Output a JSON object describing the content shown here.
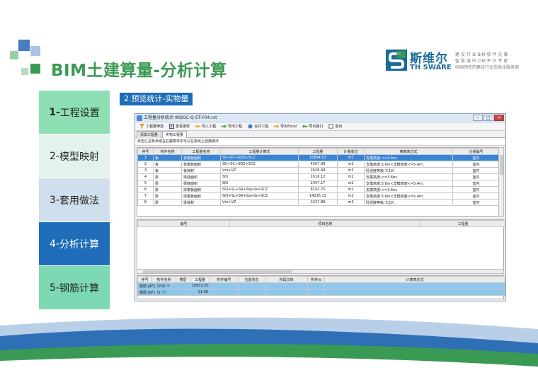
{
  "slide": {
    "title": "BIM土建算量-分析计算",
    "section_label": "2.预览统计-实物量",
    "colors": {
      "green": "#3a9a54",
      "blue": "#1f6db8"
    }
  },
  "logo": {
    "name_cn": "斯维尔",
    "name_en": "TH SWARE",
    "tagline_1": "建 设 行 业 BIM 软 件 先 锋",
    "tagline_2": "智 慧 城 市 CIM 平 台 专 家",
    "tagline_3": "中国领先的建设行业信息化服务商"
  },
  "nav": {
    "items": [
      {
        "num": "1-",
        "label": "工程设置"
      },
      {
        "num": "2-",
        "label": "模型映射"
      },
      {
        "num": "3-",
        "label": "套用做法"
      },
      {
        "num": "4-",
        "label": "分析计算"
      },
      {
        "num": "5-",
        "label": "钢筋计算"
      }
    ]
  },
  "window": {
    "title": "工程量分析统计-WDGC-Q-ST-F04.rvt",
    "controls": {
      "min": "–",
      "max": "□",
      "close": "×"
    },
    "toolbar": [
      "工程量筛选",
      "查看报表",
      "导入工程",
      "导出工程",
      "合并工程",
      "导出Excel",
      "导出接口",
      "退出"
    ],
    "tabs": [
      "清单工程量",
      "实物工程量"
    ],
    "hint": "双击汇总条目或在右键菜单中可以在条目上挂接做法",
    "top_table": {
      "headers": [
        "序号",
        "构件名称",
        "工程量名称",
        "工程量计算式",
        "工程量",
        "计量单位",
        "换算表达式",
        "分组编号"
      ],
      "rows": [
        [
          "1",
          "板",
          "板模板面积",
          "SD+SC+SDZ+SCZ",
          "10894.53",
          "m2",
          "支模高度:<=3.6m;",
          "室内"
        ],
        [
          "2",
          "板",
          "板模板面积",
          "SD+SC+SDZ+SCZ",
          "4507.08",
          "m2",
          "支模高度:3.6m<支模高度<=5.4m;",
          "室内"
        ],
        [
          "3",
          "板",
          "板体积",
          "Vm+VZ",
          "2628.49",
          "m3",
          "砼强度等级:'C30';",
          "室内"
        ],
        [
          "4",
          "梁",
          "梁底面积",
          "SDi",
          "1616.12",
          "m2",
          "支模高度:<=3.6m;",
          "室内"
        ],
        [
          "5",
          "梁",
          "梁底面积",
          "SDi",
          "2457.17",
          "m2",
          "支模高度:3.6m<支模高度<=5.4m;",
          "室内"
        ],
        [
          "6",
          "梁",
          "梁模板面积",
          "SDi+SL+SR+Sq+Sz+SCZ",
          "8192.75",
          "m2",
          "支模高度:<=3.6m;",
          "室内"
        ],
        [
          "7",
          "梁",
          "梁模板面积",
          "SDi+SL+SR+Sq+Sz+SCZ",
          "14236.13",
          "m2",
          "支模高度:3.6m<支模高度<=5.4m;",
          "室内"
        ],
        [
          "8",
          "梁",
          "梁体积",
          "Vm+VZ",
          "3237.88",
          "m3",
          "砼强度等级:'C30';",
          "室内"
        ]
      ]
    },
    "mid_table": {
      "headers": [
        "编号",
        "项目名称",
        "工程量"
      ]
    },
    "bottom_table": {
      "headers": [
        "序号",
        "构件名称",
        "楼层",
        "工程量",
        "构件编号",
        "位置信息",
        "所属文档",
        "构件Id",
        "计算表达式"
      ],
      "rows": [
        [
          "楼层:[4F]（250 个",
          "10872.55"
        ],
        [
          "楼层:[5F]（2 个）",
          "21.98"
        ]
      ]
    }
  }
}
